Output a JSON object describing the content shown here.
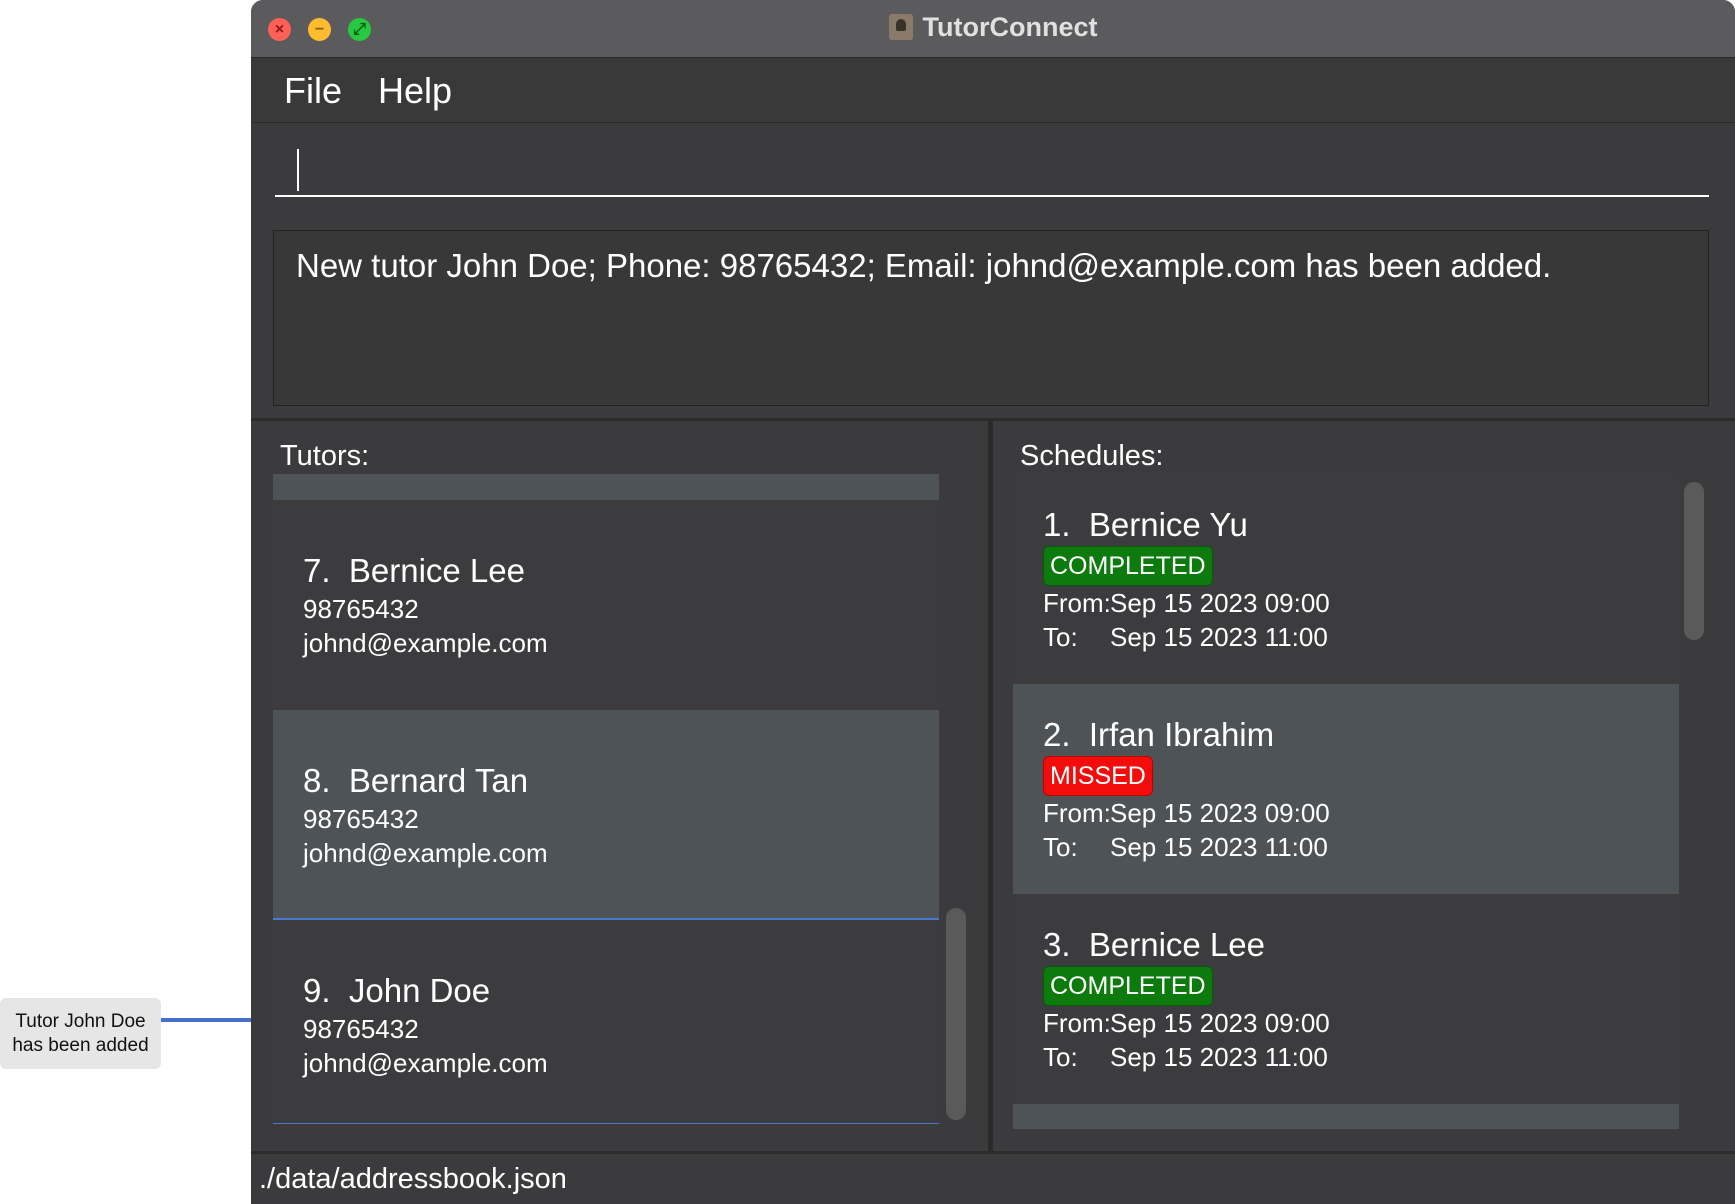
{
  "annotation": {
    "line1": "Tutor John Doe",
    "line2": "has been added",
    "accent_color": "#4a6fc9"
  },
  "window": {
    "title": "TutorConnect",
    "app_icon": "contact-book-icon"
  },
  "menu": {
    "file": "File",
    "help": "Help"
  },
  "command": {
    "value": "",
    "placeholder": ""
  },
  "result": {
    "message": "New tutor John Doe; Phone: 98765432; Email: johnd@example.com has been added."
  },
  "tutors": {
    "title": "Tutors:",
    "items": [
      {
        "index": "7.",
        "name": "Bernice Lee",
        "phone": "98765432",
        "email": "johnd@example.com"
      },
      {
        "index": "8.",
        "name": "Bernard Tan",
        "phone": "98765432",
        "email": "johnd@example.com"
      },
      {
        "index": "9.",
        "name": "John Doe",
        "phone": "98765432",
        "email": "johnd@example.com",
        "selected": true
      }
    ]
  },
  "schedules": {
    "title": "Schedules:",
    "from_label": "From:",
    "to_label": "To:",
    "items": [
      {
        "index": "1.",
        "name": "Bernice Yu",
        "status": "COMPLETED",
        "from": "Sep 15 2023 09:00",
        "to": "Sep 15 2023 11:00"
      },
      {
        "index": "2.",
        "name": "Irfan Ibrahim",
        "status": "MISSED",
        "from": "Sep 15 2023 09:00",
        "to": "Sep 15 2023 11:00"
      },
      {
        "index": "3.",
        "name": "Bernice Lee",
        "status": "COMPLETED",
        "from": "Sep 15 2023 09:00",
        "to": "Sep 15 2023 11:00"
      }
    ]
  },
  "status_colors": {
    "completed": "#0d7a0d",
    "missed": "#f20c0c",
    "selection": "#4a7ad0"
  },
  "statusbar": {
    "path": "./data/addressbook.json"
  }
}
